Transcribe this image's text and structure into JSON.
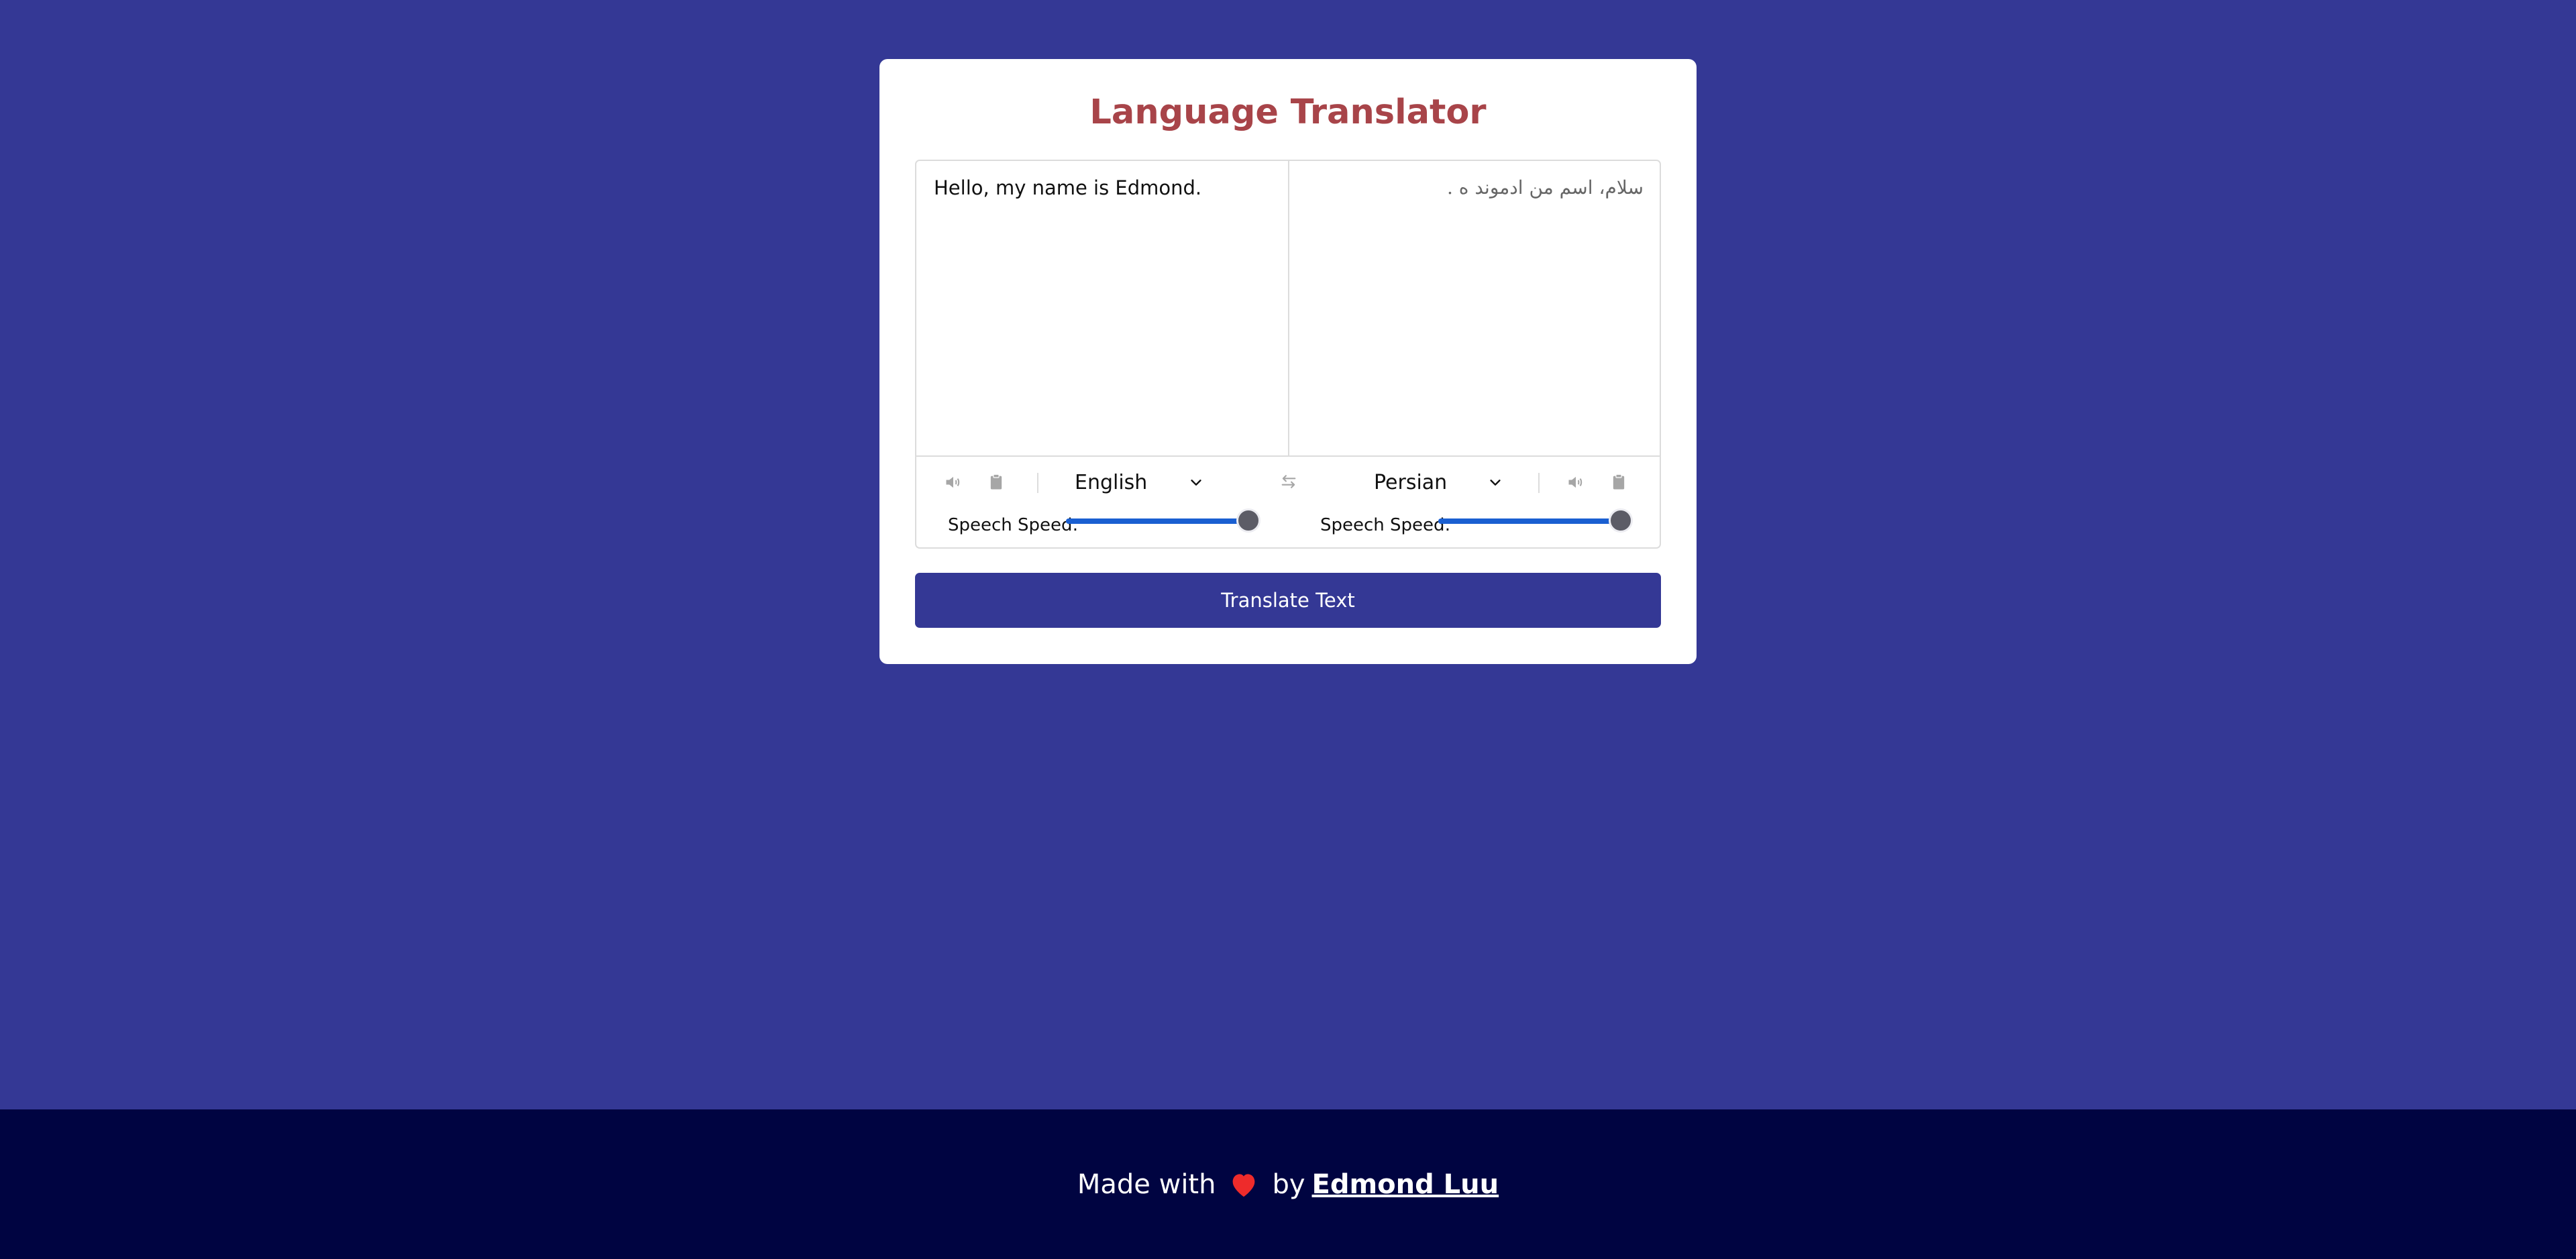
{
  "app": {
    "title": "Language Translator"
  },
  "source": {
    "text": "Hello, my name is Edmond.",
    "language": "English",
    "speed_label": "Speech Speed:",
    "speed_fraction": 1.0,
    "icons": [
      "volume-icon",
      "clipboard-icon"
    ]
  },
  "target": {
    "text": "سلام، اسم من ادموند ه .",
    "language": "Persian",
    "speed_label": "Speech Speed:",
    "speed_fraction": 1.0,
    "icons": [
      "volume-icon",
      "clipboard-icon"
    ]
  },
  "exchange_icon": "swap-arrows-icon",
  "translate_button": {
    "label": "Translate Text"
  },
  "footer": {
    "made_with": "Made with",
    "by": "by",
    "author": "Edmond Luu",
    "heart_color": "#ee2b2b"
  },
  "colors": {
    "background": "#343895",
    "title": "#a84449",
    "button": "#343895",
    "footer": "#000441",
    "slider_fill": "#1a5fd1"
  }
}
